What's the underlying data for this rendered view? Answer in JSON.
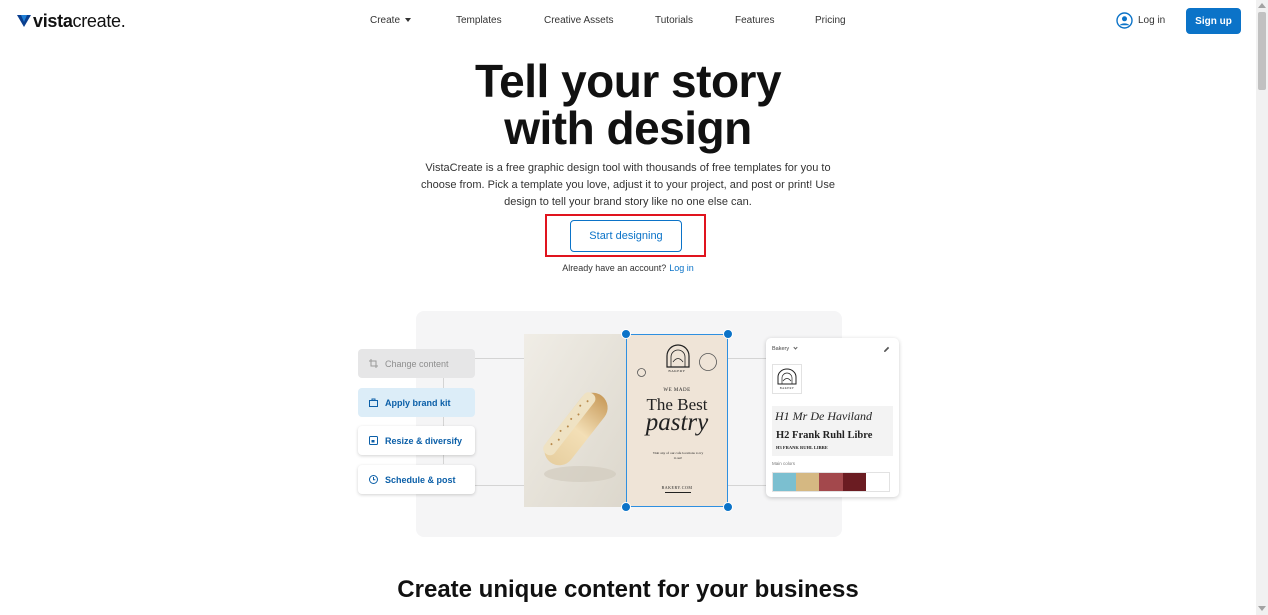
{
  "header": {
    "logo": {
      "bold": "vista",
      "light": "create."
    },
    "nav": [
      {
        "label": "Create",
        "has_caret": true
      },
      {
        "label": "Templates"
      },
      {
        "label": "Creative Assets"
      },
      {
        "label": "Tutorials"
      },
      {
        "label": "Features"
      },
      {
        "label": "Pricing"
      }
    ],
    "login_label": "Log in",
    "signup_label": "Sign up"
  },
  "hero": {
    "title_line1": "Tell your story",
    "title_line2": "with design",
    "description": "VistaCreate is a free graphic design tool with thousands of free templates for you to choose from. Pick a template you love, adjust it to your project, and post or print! Use design to tell your brand story like no one else can.",
    "cta_label": "Start designing",
    "account_prompt": "Already have an account?",
    "account_login": "Log in"
  },
  "illustration": {
    "features": [
      {
        "label": "Change content",
        "icon": "crop-icon"
      },
      {
        "label": "Apply brand kit",
        "icon": "briefcase-icon"
      },
      {
        "label": "Resize & diversify",
        "icon": "resize-icon"
      },
      {
        "label": "Schedule & post",
        "icon": "clock-icon"
      }
    ],
    "poster": {
      "bakery_label": "BAKERY",
      "we_made": "WE MADE",
      "headline": "The Best",
      "script_word": "pastry",
      "small_text": "Visit any of our cafe locations to try it out!",
      "website": "BAKERY.COM"
    },
    "brand_kit": {
      "dropdown_label": "Bakery",
      "logo_caption": "BAKERY",
      "h1_font": "H1 Mr De Haviland",
      "h2_font": "H2 Frank Ruhl Libre",
      "h3_font": "H3 FRANK RUHL LIBRE",
      "colors_label": "Main colors",
      "colors": [
        "#7bbfd0",
        "#d5b882",
        "#a3484c",
        "#6b1c22",
        "#ffffff"
      ]
    }
  },
  "section2": {
    "title": "Create unique content for your business"
  },
  "colors": {
    "accent": "#0b73c8",
    "highlight": "#e0141e"
  }
}
